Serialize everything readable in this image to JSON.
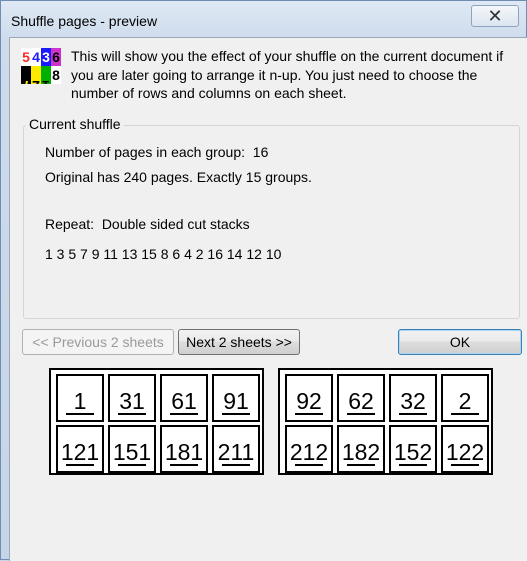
{
  "window": {
    "title": "Shuffle pages - preview",
    "close_label": "✕"
  },
  "intro": {
    "text": "This will show you the effect of your shuffle on the current document if you are later going to arrange it n-up. You just need to choose the number of rows and columns on each sheet.",
    "icon": "shuffle-pages-app-icon",
    "icon_digits_top": [
      "5",
      "4",
      "3",
      "6"
    ],
    "icon_digits_bottom": [
      "7",
      "2",
      "1",
      "8"
    ]
  },
  "current_shuffle": {
    "label": "Current shuffle",
    "pages_per_group": "Number of pages in each group:  16",
    "original_info": "Original has 240 pages. Exactly 15 groups.",
    "repeat": "Repeat:  Double sided cut stacks",
    "order": "1 3 5 7 9 11 13 15 8 6 4 2 16 14 12 10"
  },
  "buttons": {
    "previous": "<< Previous 2 sheets",
    "next": "Next 2 sheets >>",
    "ok": "OK"
  },
  "sheets": [
    {
      "top_row": [
        "1",
        "31",
        "61",
        "91"
      ],
      "bottom_row": [
        "121",
        "151",
        "181",
        "211"
      ]
    },
    {
      "top_row": [
        "92",
        "62",
        "32",
        "2"
      ],
      "bottom_row": [
        "212",
        "182",
        "152",
        "122"
      ]
    }
  ],
  "colors": {
    "icon_top": [
      "#1a1aff",
      "#ff2020",
      "#000000",
      "#cc33cc"
    ],
    "icon_bottom": [
      "#000000",
      "#ffeb00",
      "#00b000",
      "#000000"
    ]
  }
}
